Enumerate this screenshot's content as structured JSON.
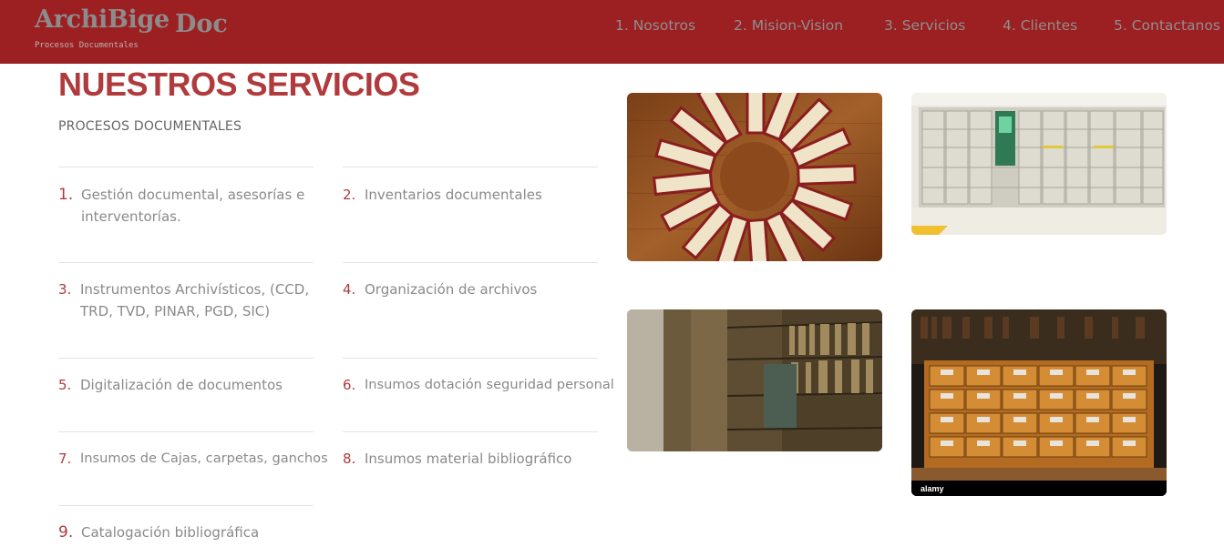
{
  "brand": {
    "name_part1": "ArchiBige",
    "name_part2": "Doc",
    "tagline": "Procesos Documentales"
  },
  "nav": {
    "items": [
      {
        "label": "1. Nosotros"
      },
      {
        "label": "2. Mision-Vision"
      },
      {
        "label": "3. Servicios"
      },
      {
        "label": "4. Clientes"
      },
      {
        "label": "5. Contactanos"
      }
    ]
  },
  "main": {
    "title": "NUESTROS SERVICIOS",
    "subtitle": "PROCESOS DOCUMENTALES",
    "services": [
      {
        "num": "1.",
        "line1": "Gestión documental, asesorías e",
        "line2": "interventorías."
      },
      {
        "num": "2.",
        "line1": "Inventarios documentales",
        "line2": ""
      },
      {
        "num": "3.",
        "line1": "Instrumentos Archivísticos, (CCD,",
        "line2": "TRD, TVD, PINAR, PGD, SIC)"
      },
      {
        "num": "4.",
        "line1": "Organización de archivos",
        "line2": ""
      },
      {
        "num": "5.",
        "line1": "Digitalización de documentos",
        "line2": ""
      },
      {
        "num": "6.",
        "line1": "Insumos dotación seguridad personal",
        "line2": ""
      },
      {
        "num": "7.",
        "line1": "Insumos de Cajas, carpetas, ganchos",
        "line2": ""
      },
      {
        "num": "8.",
        "line1": "Insumos material bibliográfico",
        "line2": ""
      },
      {
        "num": "9.",
        "line1": "Catalogación bibliográfica",
        "line2": ""
      }
    ]
  },
  "gallery": {
    "watermark": "alamy"
  },
  "colors": {
    "header_bg": "#9c1f22",
    "accent": "#b03a3c",
    "text_muted": "#8a8a8a"
  }
}
